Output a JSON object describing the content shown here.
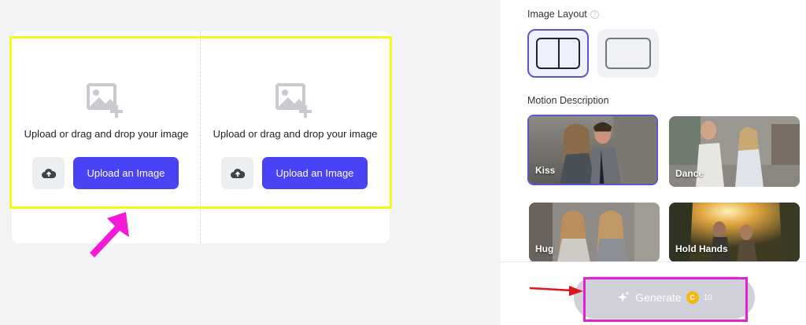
{
  "upload": {
    "slots": [
      {
        "prompt": "Upload or drag and drop your image",
        "button_label": "Upload an Image"
      },
      {
        "prompt": "Upload or drag and drop your image",
        "button_label": "Upload an Image"
      }
    ]
  },
  "settings": {
    "image_layout_label": "Image Layout",
    "motion_description_label": "Motion Description",
    "layouts": [
      {
        "name": "split",
        "selected": true
      },
      {
        "name": "single",
        "selected": false
      }
    ],
    "motions": [
      {
        "label": "Kiss",
        "selected": true
      },
      {
        "label": "Dance",
        "selected": false
      },
      {
        "label": "Hug",
        "selected": false
      },
      {
        "label": "Hold Hands",
        "selected": false
      }
    ]
  },
  "generate": {
    "label": "Generate",
    "coin_symbol": "C",
    "cost": "10"
  },
  "colors": {
    "accent": "#4a43f6",
    "highlight_yellow": "#f6f71a",
    "highlight_magenta": "#e51fd4",
    "arrow_red": "#e0141d"
  }
}
